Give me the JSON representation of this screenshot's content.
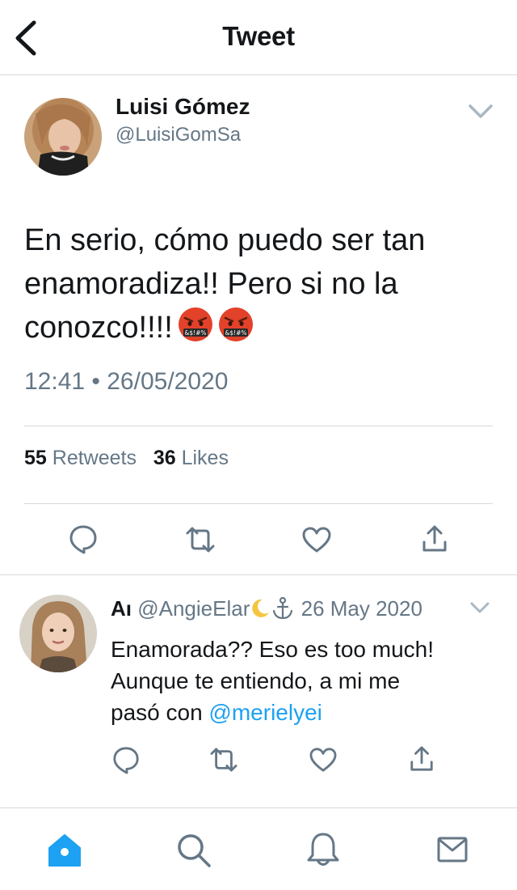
{
  "header": {
    "title": "Tweet",
    "back_icon": "chevron-left-icon"
  },
  "tweet": {
    "author_name": "Luisi Gómez",
    "author_handle": "@LuisiGomSa",
    "text_line1": "En serio, cómo puedo ser tan",
    "text_line2": "enamoradiza!! Pero si no la",
    "text_line3": "conozco!!!!",
    "emojis": [
      "face-with-symbols-on-mouth",
      "face-with-symbols-on-mouth"
    ],
    "timestamp": "12:41 • 26/05/2020",
    "retweets_count": "55",
    "retweets_label": "Retweets",
    "likes_count": "36",
    "likes_label": "Likes",
    "actions": [
      "reply-icon",
      "retweet-icon",
      "like-icon",
      "share-icon"
    ]
  },
  "reply": {
    "author_name": "Aı",
    "author_handle": "@AngieElar",
    "handle_emojis": [
      "crescent-moon",
      "anchor"
    ],
    "date": "26 May 2020",
    "text_line1": "Enamorada?? Eso es too much!",
    "text_line2": "Aunque te entiendo, a mi me",
    "text_line3_prefix": "pasó con ",
    "mention": "@merielyei",
    "actions": [
      "reply-icon",
      "retweet-icon",
      "like-icon",
      "share-icon"
    ]
  },
  "tabbar": {
    "items": [
      "home-icon",
      "search-icon",
      "notifications-icon",
      "messages-icon"
    ],
    "active": "home-icon"
  },
  "colors": {
    "accent": "#1da1f2",
    "secondary_text": "#657786",
    "icon_gray": "#657786",
    "divider": "#d9d9d9"
  }
}
